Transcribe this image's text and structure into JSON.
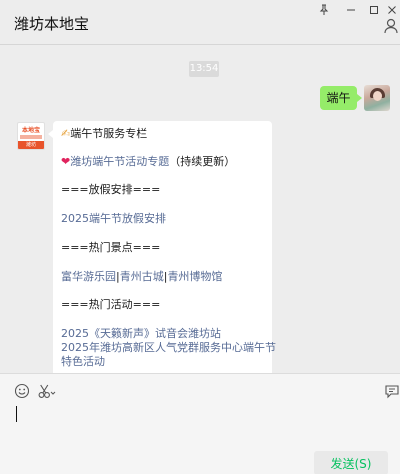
{
  "window": {
    "title": "潍坊本地宝",
    "controls": [
      "pin-icon",
      "minimize-icon",
      "maximize-icon",
      "close-icon"
    ]
  },
  "chat": {
    "time": "13:54",
    "outgoing_message": "端午",
    "incoming": {
      "avatar_logo": "本地宝",
      "avatar_band": "潍坊",
      "header": "端午节服务专栏",
      "topic_link": "潍坊端午节活动专题",
      "topic_note": "（持续更新）",
      "section_holiday": "===放假安排===",
      "holiday_link": "2025端午节放假安排",
      "section_spots": "===热门景点===",
      "spots": [
        "富华游乐园",
        "青州古城",
        "青州博物馆"
      ],
      "spots_separator": "|",
      "section_events": "===热门活动===",
      "event_1": "2025《天籁新声》试音会潍坊站",
      "event_2_line1": "2025年潍坊高新区人气党群服务中心端午节",
      "event_2_line2": "特色活动"
    }
  },
  "composer": {
    "tools": [
      "emoji-icon",
      "scissors-icon",
      "chat-bubble-icon"
    ],
    "send_label": "发送(S)"
  }
}
